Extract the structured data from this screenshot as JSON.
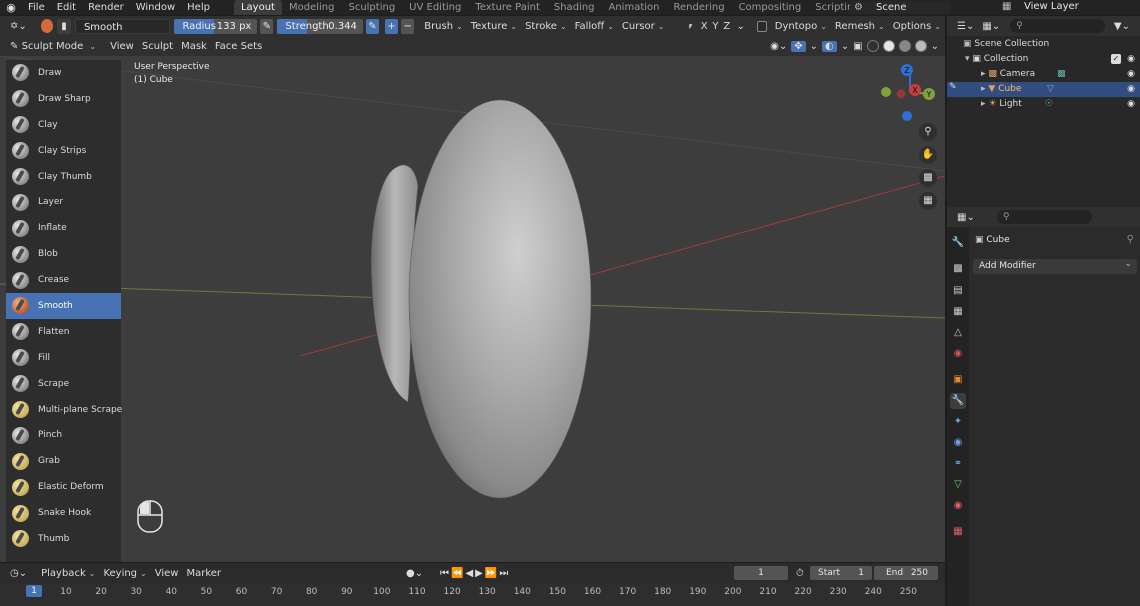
{
  "menu": {
    "items": [
      "File",
      "Edit",
      "Render",
      "Window",
      "Help"
    ]
  },
  "workspaces": {
    "tabs": [
      "Layout",
      "Modeling",
      "Sculpting",
      "UV Editing",
      "Texture Paint",
      "Shading",
      "Animation",
      "Rendering",
      "Compositing",
      "Scripting"
    ],
    "active": "Layout",
    "add": "+"
  },
  "scene": {
    "name": "Scene"
  },
  "view_layer": {
    "name": "View Layer"
  },
  "tool_header": {
    "brush_name": "Smooth",
    "radius_label": "Radius",
    "radius_value": "133 px",
    "radius_fill": 0.48,
    "strength_label": "Strength",
    "strength_value": "0.344",
    "strength_fill": 0.344,
    "minus": "−",
    "plus": "+",
    "brush_menu": "Brush",
    "texture_menu": "Texture",
    "stroke_menu": "Stroke",
    "falloff_menu": "Falloff",
    "cursor_menu": "Cursor",
    "axes": [
      "X",
      "Y",
      "Z"
    ],
    "dyntopo": "Dyntopo",
    "remesh": "Remesh",
    "options": "Options"
  },
  "viewport_header": {
    "mode": "Sculpt Mode",
    "menus": [
      "View",
      "Sculpt",
      "Mask",
      "Face Sets"
    ]
  },
  "viewport": {
    "perspective": "User Perspective",
    "object": "(1) Cube"
  },
  "toolbar": {
    "tools": [
      "Draw",
      "Draw Sharp",
      "Clay",
      "Clay Strips",
      "Clay Thumb",
      "Layer",
      "Inflate",
      "Blob",
      "Crease",
      "Smooth",
      "Flatten",
      "Fill",
      "Scrape",
      "Multi-plane Scrape",
      "Pinch",
      "Grab",
      "Elastic Deform",
      "Snake Hook",
      "Thumb"
    ],
    "active": "Smooth"
  },
  "gizmo": {
    "x": "X",
    "y": "Y",
    "z": "Z"
  },
  "timeline": {
    "menus": [
      "Playback",
      "Keying",
      "View",
      "Marker"
    ],
    "current_frame": "1",
    "start_label": "Start",
    "start_value": "1",
    "end_label": "End",
    "end_value": "250",
    "ticks": [
      "1",
      "10",
      "20",
      "30",
      "40",
      "50",
      "60",
      "70",
      "80",
      "90",
      "100",
      "110",
      "120",
      "130",
      "140",
      "150",
      "160",
      "170",
      "180",
      "190",
      "200",
      "210",
      "220",
      "230",
      "240",
      "250"
    ]
  },
  "outliner": {
    "rows": [
      {
        "label": "Scene Collection",
        "icon": "scene-collection-icon"
      },
      {
        "label": "Collection",
        "icon": "collection-icon"
      },
      {
        "label": "Camera",
        "icon": "camera-icon"
      },
      {
        "label": "Cube",
        "icon": "mesh-icon"
      },
      {
        "label": "Light",
        "icon": "light-icon"
      }
    ],
    "selected": "Cube"
  },
  "properties": {
    "object_name": "Cube",
    "add_modifier": "Add Modifier"
  },
  "colors": {
    "accent": "#4772b3",
    "viewport_bg": "#3d3d3d",
    "panel_bg": "#2d2d2d",
    "x_axis": "#c83c3c",
    "y_axis": "#7fa23a",
    "z_axis": "#2f6fd6",
    "selection": "#334d80"
  }
}
